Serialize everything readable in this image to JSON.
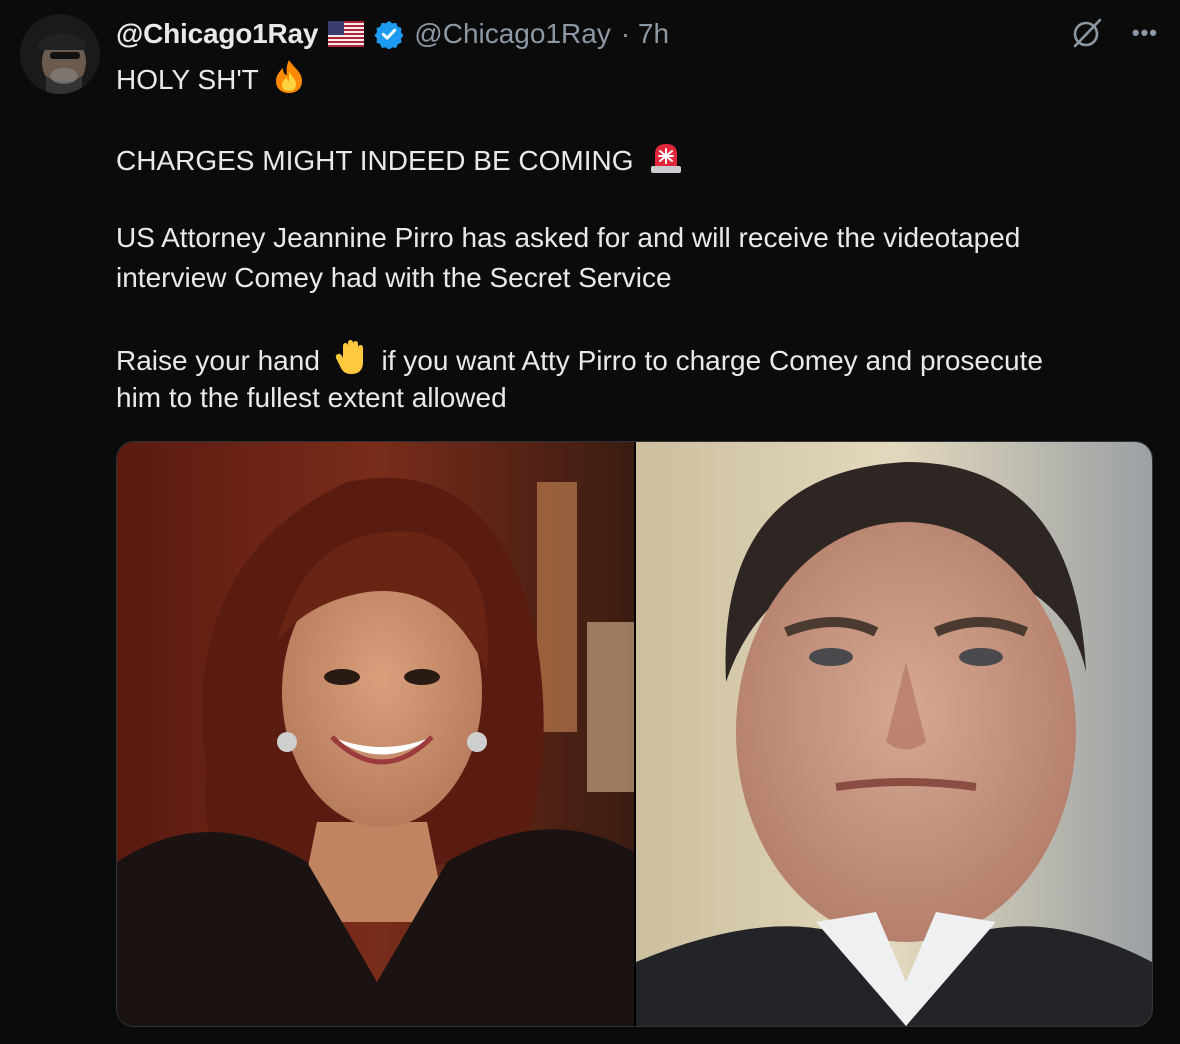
{
  "post": {
    "display_name": "@Chicago1Ray",
    "handle": "@Chicago1Ray",
    "time": "· 7h",
    "lines": [
      "HOLY SH'T",
      "CHARGES MIGHT INDEED BE COMING",
      "US Attorney Jeannine Pirro has asked for and will receive the videotaped",
      "interview Comey had with the Secret Service",
      "Raise your hand",
      "if you want Atty Pirro to charge Comey and prosecute",
      "him to the fullest extent allowed"
    ],
    "emojis": [
      "fire-emoji",
      "rotating-light-emoji",
      "raised-hand-emoji"
    ],
    "media": [
      {
        "icon": "photo-woman-smiling"
      },
      {
        "icon": "photo-man-in-suit"
      }
    ]
  },
  "icons": {
    "flag": "us-flag-icon",
    "verified": "verified-badge-icon",
    "grok": "grok-icon",
    "more": "more-options-icon"
  },
  "colors": {
    "background": "#0b0b0b",
    "text": "#e7e9ea",
    "secondary": "#8b98a5",
    "verified": "#1d9bf0"
  }
}
